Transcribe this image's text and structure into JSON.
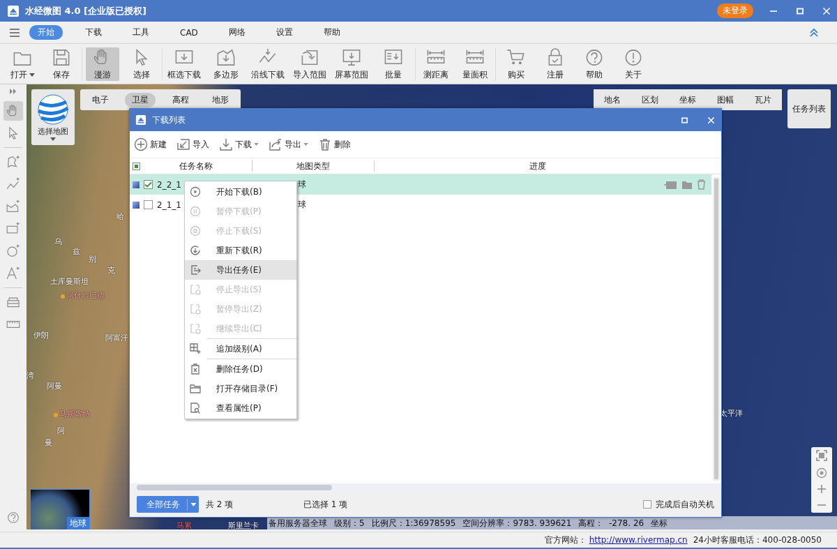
{
  "window": {
    "title": "水经微图 4.0 [企业版已授权]",
    "login_badge": "未登录"
  },
  "menu_tabs": [
    {
      "label": "开始",
      "selected": true
    },
    {
      "label": "下载",
      "selected": false
    },
    {
      "label": "工具",
      "selected": false
    },
    {
      "label": "CAD",
      "selected": false
    },
    {
      "label": "网络",
      "selected": false
    },
    {
      "label": "设置",
      "selected": false
    },
    {
      "label": "帮助",
      "selected": false
    }
  ],
  "toolbar": [
    {
      "items": [
        {
          "label": "打开",
          "dropdown": true,
          "selected": false
        },
        {
          "label": "保存",
          "dropdown": false,
          "selected": false
        }
      ]
    },
    {
      "items": [
        {
          "label": "漫游",
          "dropdown": false,
          "selected": true
        },
        {
          "label": "选择",
          "dropdown": false,
          "selected": false
        }
      ]
    },
    {
      "items": [
        {
          "label": "框选下载",
          "dropdown": false,
          "selected": false
        },
        {
          "label": "多边形",
          "dropdown": false,
          "selected": false
        },
        {
          "label": "沿线下载",
          "dropdown": false,
          "selected": false
        },
        {
          "label": "导入范围",
          "dropdown": false,
          "selected": false
        },
        {
          "label": "屏幕范围",
          "dropdown": false,
          "selected": false
        },
        {
          "label": "批量",
          "dropdown": false,
          "selected": false
        }
      ]
    },
    {
      "items": [
        {
          "label": "测距离",
          "dropdown": false,
          "selected": false
        },
        {
          "label": "量面积",
          "dropdown": false,
          "selected": false
        }
      ]
    },
    {
      "items": [
        {
          "label": "购买",
          "dropdown": false,
          "selected": false
        },
        {
          "label": "注册",
          "dropdown": false,
          "selected": false
        },
        {
          "label": "帮助",
          "dropdown": false,
          "selected": false
        },
        {
          "label": "关于",
          "dropdown": false,
          "selected": false
        }
      ]
    }
  ],
  "left_tools": [
    {
      "selected": true
    },
    {
      "selected": false
    },
    {
      "selected": false
    },
    {
      "selected": false
    },
    {
      "selected": false
    },
    {
      "selected": false
    },
    {
      "selected": false
    },
    {
      "selected": false
    },
    {
      "selected": false
    },
    {
      "selected": false
    }
  ],
  "map": {
    "choose_map": "选择地图",
    "layer_tabs": [
      {
        "label": "电子",
        "selected": false
      },
      {
        "label": "卫星",
        "selected": true
      },
      {
        "label": "高程",
        "selected": false
      },
      {
        "label": "地形",
        "selected": false
      }
    ],
    "overlay_tabs": [
      "地名",
      "区划",
      "坐标",
      "图幅",
      "瓦片"
    ],
    "task_list_button": "任务列表",
    "minimap_label": "地球",
    "labels": [
      {
        "text": "哈",
        "kind": "place"
      },
      {
        "text": "乌",
        "kind": "place"
      },
      {
        "text": "兹",
        "kind": "place"
      },
      {
        "text": "别",
        "kind": "place"
      },
      {
        "text": "克",
        "kind": "place"
      },
      {
        "text": "土库曼斯坦",
        "kind": "place"
      },
      {
        "text": "阿什哈巴德",
        "kind": "capital"
      },
      {
        "text": "伊朗",
        "kind": "place"
      },
      {
        "text": "阿富汗",
        "kind": "place"
      },
      {
        "text": "湾",
        "kind": "place"
      },
      {
        "text": "阿曼",
        "kind": "place"
      },
      {
        "text": "马斯喀特",
        "kind": "capital"
      },
      {
        "text": "阿",
        "kind": "place"
      },
      {
        "text": "曼",
        "kind": "place"
      },
      {
        "text": "马累",
        "kind": "city"
      },
      {
        "text": "斯里兰卡",
        "kind": "place"
      },
      {
        "text": "太平洋",
        "kind": "place"
      }
    ],
    "status": [
      "备用服务器全球",
      "级别：5",
      "比例尺：1:36978595",
      "空间分辨率：9783. 939621",
      "高程：  -278. 26",
      "坐标"
    ]
  },
  "dialog": {
    "title": "下载列表",
    "buttons": [
      {
        "label": "新建",
        "dropdown": false
      },
      {
        "label": "导入",
        "dropdown": false
      },
      {
        "label": "下载",
        "dropdown": true
      },
      {
        "label": "导出",
        "dropdown": true
      },
      {
        "label": "删除",
        "dropdown": false
      }
    ],
    "columns": [
      "任务名称",
      "地图类型",
      "进度"
    ],
    "all_checked": true,
    "rows": [
      {
        "name": "2_2_1",
        "map_type": "球",
        "checked": true,
        "selected": true
      },
      {
        "name": "2_1_1",
        "map_type": "球",
        "checked": false,
        "selected": false
      }
    ],
    "context_menu": [
      {
        "label": "开始下载(B)",
        "disabled": false,
        "highlighted": false,
        "separator_before": false
      },
      {
        "label": "暂停下载(P)",
        "disabled": true,
        "highlighted": false,
        "separator_before": false
      },
      {
        "label": "停止下载(S)",
        "disabled": true,
        "highlighted": false,
        "separator_before": false
      },
      {
        "label": "重新下载(R)",
        "disabled": false,
        "highlighted": false,
        "separator_before": false
      },
      {
        "label": "导出任务(E)",
        "disabled": false,
        "highlighted": true,
        "separator_before": false
      },
      {
        "label": "停止导出(S)",
        "disabled": true,
        "highlighted": false,
        "separator_before": false
      },
      {
        "label": "暂停导出(Z)",
        "disabled": true,
        "highlighted": false,
        "separator_before": false
      },
      {
        "label": "继续导出(C)",
        "disabled": true,
        "highlighted": false,
        "separator_before": false
      },
      {
        "label": "追加级别(A)",
        "disabled": false,
        "highlighted": false,
        "separator_before": true
      },
      {
        "label": "删除任务(D)",
        "disabled": false,
        "highlighted": false,
        "separator_before": true
      },
      {
        "label": "打开存储目录(F)",
        "disabled": false,
        "highlighted": false,
        "separator_before": false
      },
      {
        "label": "查看属性(P)",
        "disabled": false,
        "highlighted": false,
        "separator_before": false
      }
    ],
    "filter_button": "全部任务",
    "total": "共 2 项",
    "selected_count": "已选择 1 项",
    "auto_shutdown": {
      "label": "完成后自动关机",
      "checked": false
    }
  },
  "footer": {
    "website_label": "官方网站：",
    "website_link": "http://www.rivermap.cn",
    "phone": "24小时客服电话：400-028-0050"
  }
}
